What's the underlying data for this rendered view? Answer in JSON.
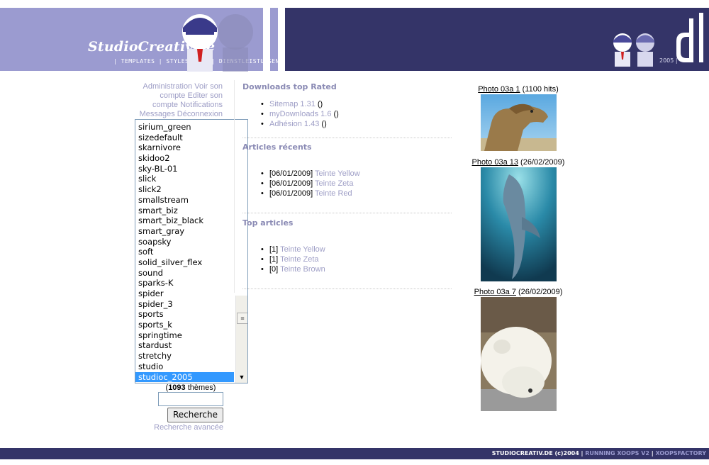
{
  "header": {
    "logo": "StudioCreativ.de",
    "tagline": "| TEMPLATES | STYLESHEETS | DIENSTLEISTUNGEN |",
    "year": "2005 |",
    "dl_mark": "dl"
  },
  "user_menu": {
    "administration": "Administration",
    "voir_compte": "Voir son compte",
    "editer_compte": "Editer son compte",
    "notifications": "Notifications",
    "messages": "Messages",
    "deconnexion": "Déconnexion"
  },
  "themes": {
    "items": [
      "sirium_green",
      "sizedefault",
      "skarnivore",
      "skidoo2",
      "sky-BL-01",
      "slick",
      "slick2",
      "smallstream",
      "smart_biz",
      "smart_biz_black",
      "smart_gray",
      "soapsky",
      "soft",
      "solid_silver_flex",
      "sound",
      "sparks-K",
      "spider",
      "spider_3",
      "sports",
      "sports_k",
      "springtime",
      "stardust",
      "stretchy",
      "studio",
      "studioc_2005"
    ],
    "selected": "studioc_2005",
    "count_number": "1093",
    "count_suffix": " thèmes)",
    "count_prefix": "("
  },
  "search": {
    "input_value": "",
    "button_label": "Recherche",
    "advanced_label": "Recherche avancée"
  },
  "downloads_top_rated": {
    "title": "Downloads top Rated",
    "items": [
      {
        "label": "Sitemap 1.31",
        "suffix": " ()"
      },
      {
        "label": "myDownloads 1.6",
        "suffix": " ()"
      },
      {
        "label": "Adhésion 1.43",
        "suffix": " ()"
      }
    ]
  },
  "recent_articles": {
    "title": "Articles récents",
    "items": [
      {
        "date": "[06/01/2009]",
        "label": "Teinte Yellow"
      },
      {
        "date": "[06/01/2009]",
        "label": "Teinte Zeta"
      },
      {
        "date": "[06/01/2009]",
        "label": "Teinte Red"
      }
    ]
  },
  "top_articles": {
    "title": "Top articles",
    "items": [
      {
        "rank": "[1]",
        "label": "Teinte Yellow"
      },
      {
        "rank": "[1]",
        "label": "Teinte Zeta"
      },
      {
        "rank": "[0]",
        "label": "Teinte Brown"
      }
    ]
  },
  "photos": [
    {
      "title": "Photo 03a 1",
      "info": " (1100 hits)"
    },
    {
      "title": "Photo 03a 13",
      "info": " (26/02/2009)"
    },
    {
      "title": "Photo 03a 7",
      "info": " (26/02/2009)"
    }
  ],
  "footer": {
    "copyright": "STUDIOCREATIV.DE (c)2004",
    "running": "RUNNING XOOPS V2",
    "factory": "XOOPSFACTORY",
    "sep": " | "
  },
  "colors": {
    "header_light": "#9b9bd0",
    "header_dark": "#343468",
    "link": "#9e9ec6",
    "selected": "#3399ff"
  }
}
